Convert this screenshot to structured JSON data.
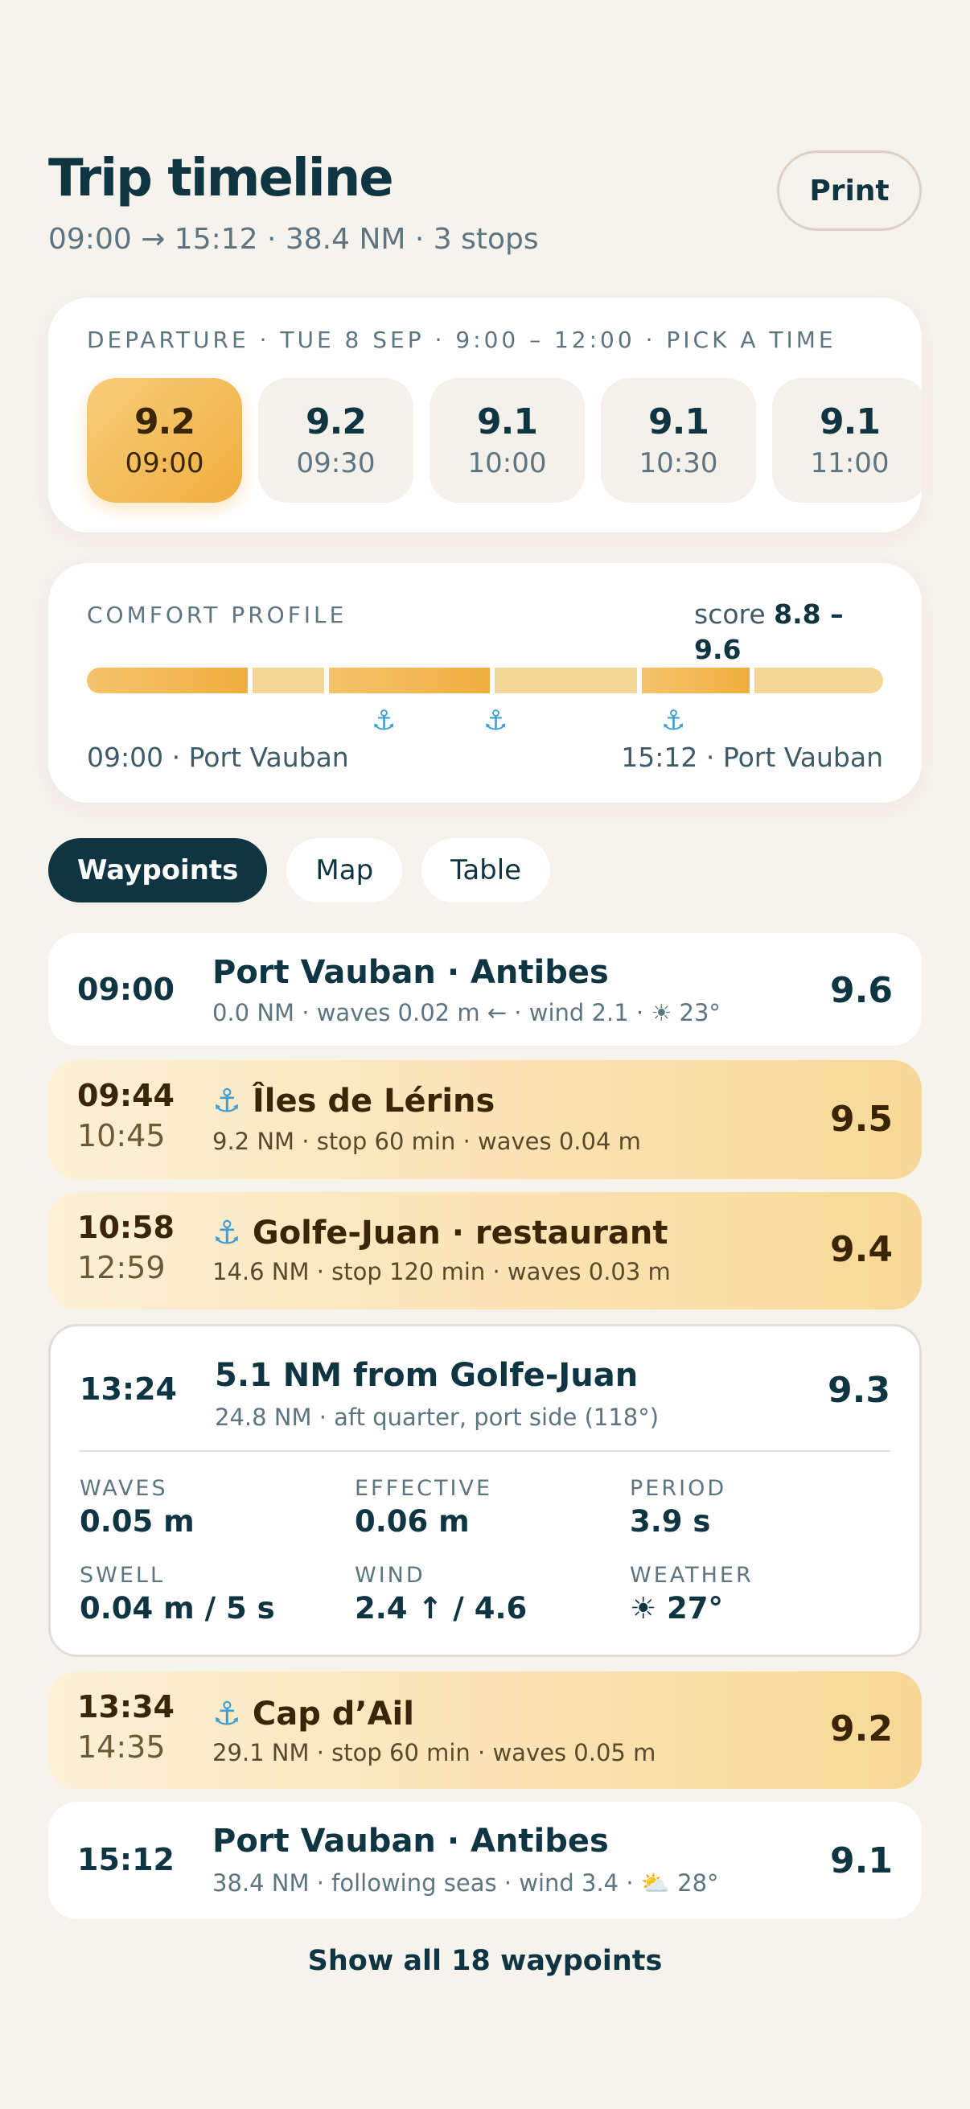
{
  "header": {
    "title": "Trip timeline",
    "subtitle": "09:00 → 15:12 · 38.4 NM · 3 stops",
    "print_label": "Print"
  },
  "departure": {
    "caption": "DEPARTURE · TUE 8 SEP · 9:00 – 12:00 · PICK A TIME",
    "slots": [
      {
        "score": "9.2",
        "time": "09:00",
        "selected": true
      },
      {
        "score": "9.2",
        "time": "09:30"
      },
      {
        "score": "9.1",
        "time": "10:00"
      },
      {
        "score": "9.1",
        "time": "10:30"
      },
      {
        "score": "9.1",
        "time": "11:00"
      }
    ]
  },
  "comfort": {
    "caption": "COMFORT PROFILE",
    "score_prefix": "score ",
    "score_range": "8.8 – 9.6",
    "start_label": "09:00 · Port Vauban",
    "end_label": "15:12 · Port Vauban",
    "anchor_glyph": "⚓"
  },
  "tabs": [
    "Waypoints",
    "Map",
    "Table"
  ],
  "waypoints": [
    {
      "time": "09:00",
      "name": "Port Vauban · Antibes",
      "meta": "0.0 NM · waves 0.02 m ← · wind 2.1 · ☀ 23°",
      "score": "9.6"
    },
    {
      "time": "09:44",
      "time2": "10:45",
      "name": "Îles de Lérins",
      "meta": "9.2 NM · stop 60 min · waves 0.04 m",
      "score": "9.5"
    },
    {
      "time": "10:58",
      "time2": "12:59",
      "name": "Golfe-Juan · restaurant",
      "meta": "14.6 NM · stop 120 min · waves 0.03 m",
      "score": "9.4"
    },
    {
      "time": "13:24",
      "name": "5.1 NM from Golfe-Juan",
      "meta": "24.8 NM · aft quarter, port side (118°)",
      "score": "9.3"
    },
    {
      "time": "13:34",
      "time2": "14:35",
      "name": "Cap d’Ail",
      "meta": "29.1 NM · stop 60 min · waves 0.05 m",
      "score": "9.2"
    },
    {
      "time": "15:12",
      "name": "Port Vauban · Antibes",
      "meta": "38.4 NM · following seas · wind 3.4 · ⛅ 28°",
      "score": "9.1"
    }
  ],
  "details": {
    "waves_label": "WAVES",
    "waves": "0.05 m",
    "effective_label": "EFFECTIVE",
    "effective": "0.06 m",
    "period_label": "PERIOD",
    "period": "3.9 s",
    "swell_label": "SWELL",
    "swell": "0.04 m / 5 s",
    "wind_label": "WIND",
    "wind": "2.4 ↑ / 4.6",
    "weather_label": "WEATHER",
    "weather": "☀ 27°"
  },
  "show_all": "Show all 18 waypoints",
  "colors": {
    "navy": "#0f3442",
    "amber": "#f0ae3f",
    "anchor": "#3e9fd6",
    "background": "#f6f2ec"
  }
}
